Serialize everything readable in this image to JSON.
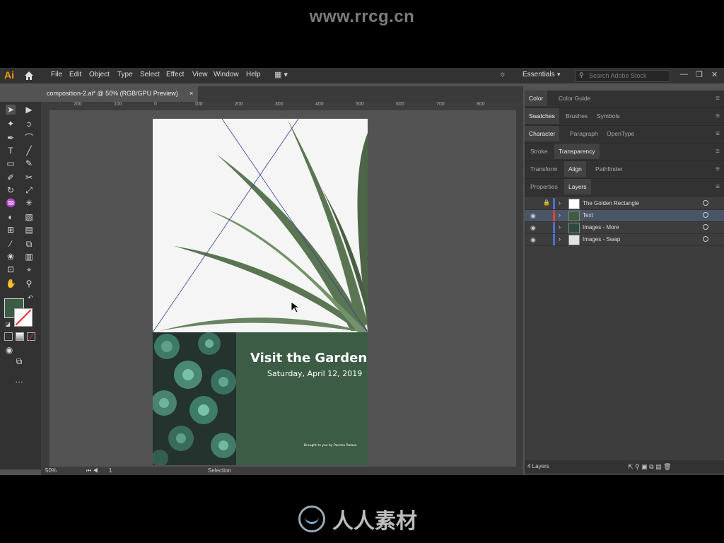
{
  "watermark": {
    "url": "www.rrcg.cn",
    "brand": "人人素材"
  },
  "app": {
    "logo": "Ai"
  },
  "menu": [
    "File",
    "Edit",
    "Object",
    "Type",
    "Select",
    "Effect",
    "View",
    "Window",
    "Help"
  ],
  "workspace": "Essentials",
  "search_placeholder": "Search Adobe Stock",
  "document": {
    "tab_label": "composition-2.ai* @ 50% (RGB/GPU Preview)",
    "close": "×"
  },
  "artwork": {
    "title": "Visit the Garden",
    "date": "Saturday, April 12, 2019",
    "credit": "Brought to you by Pancho Relaxo",
    "fill_color": "#3d5c45"
  },
  "ruler": {
    "h_ticks": [
      "200",
      "100",
      "0",
      "100",
      "200",
      "300",
      "400",
      "500",
      "600",
      "700",
      "800"
    ]
  },
  "status": {
    "zoom": "50%",
    "page": "1",
    "tool": "Selection"
  },
  "panels": {
    "row1": [
      "Color",
      "Color Guide"
    ],
    "row2": [
      "Swatches",
      "Brushes",
      "Symbols"
    ],
    "row3": [
      "Character",
      "Paragraph",
      "OpenType"
    ],
    "row4": [
      "Stroke",
      "Transparency"
    ],
    "row5": [
      "Transform",
      "Align",
      "Pathfinder"
    ],
    "row6": [
      "Properties",
      "Layers"
    ]
  },
  "layers": [
    {
      "name": "The Golden Rectangle",
      "color": "#4a6fd6",
      "visible": false,
      "locked": true
    },
    {
      "name": "Text",
      "color": "#e04040",
      "visible": true,
      "locked": false
    },
    {
      "name": "Images - More",
      "color": "#4a6fd6",
      "visible": true,
      "locked": false
    },
    {
      "name": "Images - Swap",
      "color": "#4a6fd6",
      "visible": true,
      "locked": false
    }
  ],
  "layers_count": "4 Layers"
}
